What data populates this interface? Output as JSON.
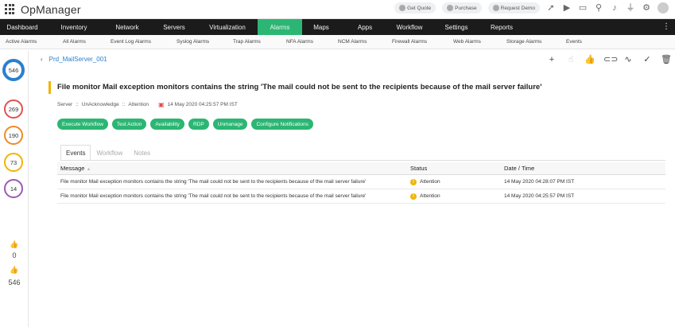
{
  "app": {
    "title": "OpManager"
  },
  "topbar": {
    "get_quote": "Get Quote",
    "purchase": "Purchase",
    "request_demo": "Request Demo"
  },
  "mainnav": [
    "Dashboard",
    "Inventory",
    "Network",
    "Servers",
    "Virtualization",
    "Alarms",
    "Maps",
    "Apps",
    "Workflow",
    "Settings",
    "Reports"
  ],
  "active_main": "Alarms",
  "subnav": [
    "Active Alarms",
    "All Alarms",
    "Event Log Alarms",
    "Syslog Alarms",
    "Trap Alarms",
    "NFA Alarms",
    "NCM Alarms",
    "Firewall Alarms",
    "Web Alarms",
    "Storage Alarms",
    "Events"
  ],
  "sidebar": {
    "total": "546",
    "critical": "269",
    "trouble": "190",
    "attention": "73",
    "service_down": "14",
    "ack_count": "0",
    "unack_count": "546"
  },
  "detail": {
    "device": "Prd_MailServer_001",
    "title": "File monitor Mail exception monitors contains the string 'The mail could not be sent to the recipients because of the mail server failure'",
    "category": "Server",
    "ack_state": "UnAcknowledge",
    "severity": "Attention",
    "timestamp": "14 May 2020 04:25:57 PM IST",
    "buttons": [
      "Execute Workflow",
      "Test Action",
      "Availability",
      "RDP",
      "Unmanage",
      "Configure Notifications"
    ]
  },
  "tabs": [
    "Events",
    "Workflow",
    "Notes"
  ],
  "active_tab": "Events",
  "table": {
    "headers": [
      "Message",
      "Status",
      "Date / Time"
    ],
    "rows": [
      {
        "message": "File monitor Mail exception monitors contains the string 'The mail could not be sent to the recipients because of the mail server failure'",
        "status": "Attention",
        "datetime": "14 May 2020 04:28:07 PM IST"
      },
      {
        "message": "File monitor Mail exception monitors contains the string 'The mail could not be sent to the recipients because of the mail server failure'",
        "status": "Attention",
        "datetime": "14 May 2020 04:25:57 PM IST"
      }
    ]
  },
  "colors": {
    "accent": "#2bb673",
    "nav_bg": "#1b1b1b",
    "critical": "#e05050",
    "trouble": "#f08a24",
    "attention": "#f0b400",
    "service_down": "#9b59b6",
    "link": "#2a7fd1"
  }
}
